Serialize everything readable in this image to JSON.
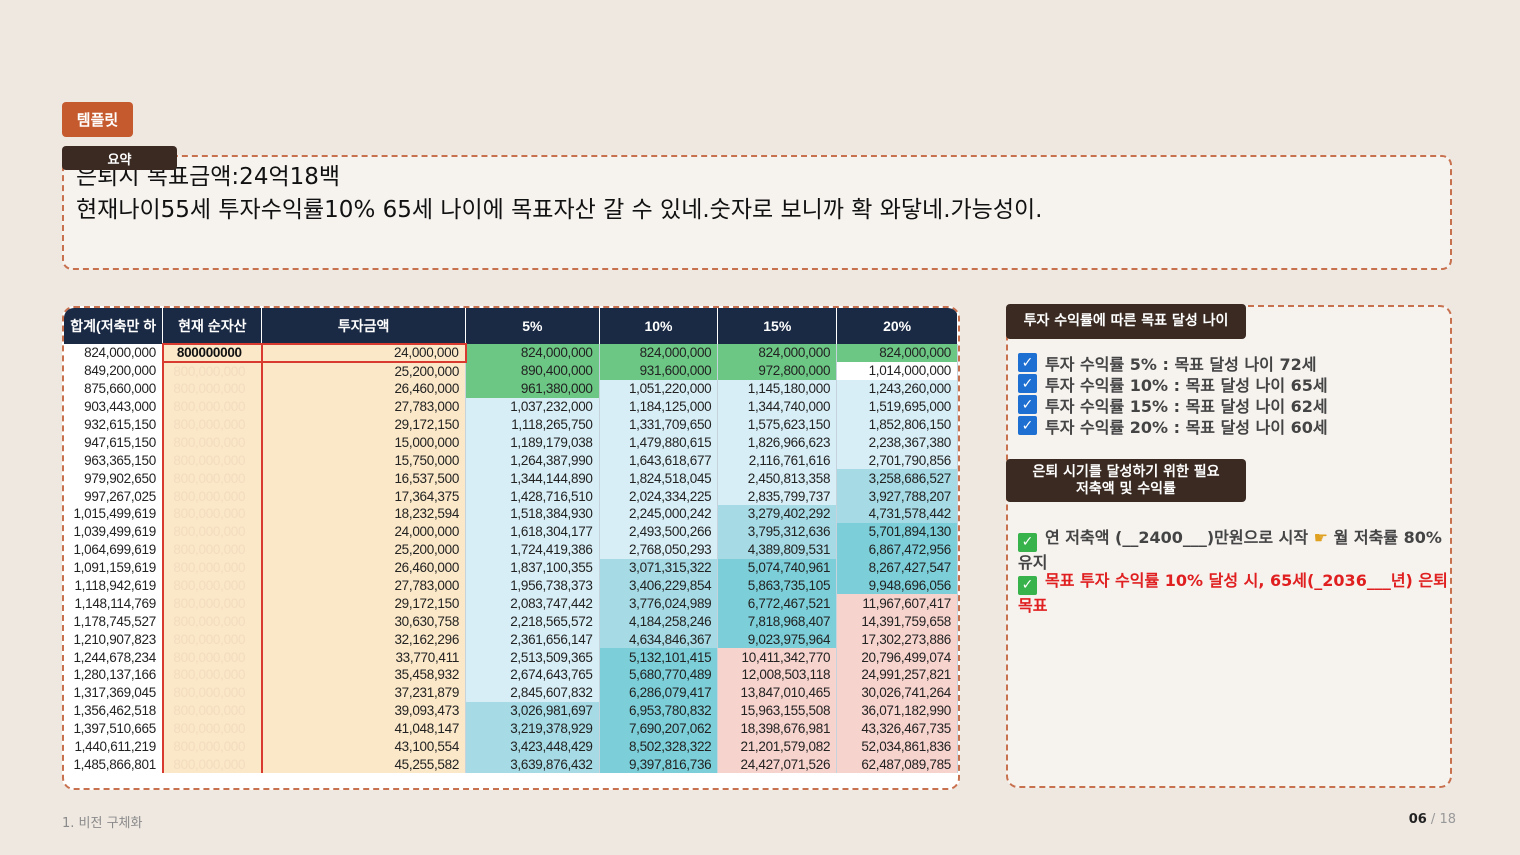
{
  "tag": "템플릿",
  "summary": {
    "label": "요약",
    "line1": "은퇴시 목표금액:24억18백",
    "line2": "현재나이55세 투자수익률10% 65세 나이에 목표자산 갈 수 있네.숫자로 보니까 확 와닿네.가능성이."
  },
  "table": {
    "headers": [
      "합계(저축만 하",
      "현재 순자산",
      "투자금액",
      "5%",
      "10%",
      "15%",
      "20%"
    ],
    "net_first": "800000000",
    "net_rest": "800,000,000",
    "rows": [
      [
        "824,000,000",
        "24,000,000",
        "824,000,000",
        "824,000,000",
        "824,000,000",
        "824,000,000"
      ],
      [
        "849,200,000",
        "25,200,000",
        "890,400,000",
        "931,600,000",
        "972,800,000",
        "1,014,000,000"
      ],
      [
        "875,660,000",
        "26,460,000",
        "961,380,000",
        "1,051,220,000",
        "1,145,180,000",
        "1,243,260,000"
      ],
      [
        "903,443,000",
        "27,783,000",
        "1,037,232,000",
        "1,184,125,000",
        "1,344,740,000",
        "1,519,695,000"
      ],
      [
        "932,615,150",
        "29,172,150",
        "1,118,265,750",
        "1,331,709,650",
        "1,575,623,150",
        "1,852,806,150"
      ],
      [
        "947,615,150",
        "15,000,000",
        "1,189,179,038",
        "1,479,880,615",
        "1,826,966,623",
        "2,238,367,380"
      ],
      [
        "963,365,150",
        "15,750,000",
        "1,264,387,990",
        "1,643,618,677",
        "2,116,761,616",
        "2,701,790,856"
      ],
      [
        "979,902,650",
        "16,537,500",
        "1,344,144,890",
        "1,824,518,045",
        "2,450,813,358",
        "3,258,686,527"
      ],
      [
        "997,267,025",
        "17,364,375",
        "1,428,716,510",
        "2,024,334,225",
        "2,835,799,737",
        "3,927,788,207"
      ],
      [
        "1,015,499,619",
        "18,232,594",
        "1,518,384,930",
        "2,245,000,242",
        "3,279,402,292",
        "4,731,578,442"
      ],
      [
        "1,039,499,619",
        "24,000,000",
        "1,618,304,177",
        "2,493,500,266",
        "3,795,312,636",
        "5,701,894,130"
      ],
      [
        "1,064,699,619",
        "25,200,000",
        "1,724,419,386",
        "2,768,050,293",
        "4,389,809,531",
        "6,867,472,956"
      ],
      [
        "1,091,159,619",
        "26,460,000",
        "1,837,100,355",
        "3,071,315,322",
        "5,074,740,961",
        "8,267,427,547"
      ],
      [
        "1,118,942,619",
        "27,783,000",
        "1,956,738,373",
        "3,406,229,854",
        "5,863,735,105",
        "9,948,696,056"
      ],
      [
        "1,148,114,769",
        "29,172,150",
        "2,083,747,442",
        "3,776,024,989",
        "6,772,467,521",
        "11,967,607,417"
      ],
      [
        "1,178,745,527",
        "30,630,758",
        "2,218,565,572",
        "4,184,258,246",
        "7,818,968,407",
        "14,391,759,658"
      ],
      [
        "1,210,907,823",
        "32,162,296",
        "2,361,656,147",
        "4,634,846,367",
        "9,023,975,964",
        "17,302,273,886"
      ],
      [
        "1,244,678,234",
        "33,770,411",
        "2,513,509,365",
        "5,132,101,415",
        "10,411,342,770",
        "20,796,499,074"
      ],
      [
        "1,280,137,166",
        "35,458,932",
        "2,674,643,765",
        "5,680,770,489",
        "12,008,503,118",
        "24,991,257,821"
      ],
      [
        "1,317,369,045",
        "37,231,879",
        "2,845,607,832",
        "6,286,079,417",
        "13,847,010,465",
        "30,026,741,264"
      ],
      [
        "1,356,462,518",
        "39,093,473",
        "3,026,981,697",
        "6,953,780,832",
        "15,963,155,508",
        "36,071,182,990"
      ],
      [
        "1,397,510,665",
        "41,048,147",
        "3,219,378,929",
        "7,690,207,062",
        "18,398,676,981",
        "43,326,467,735"
      ],
      [
        "1,440,611,219",
        "43,100,554",
        "3,423,448,429",
        "8,502,328,322",
        "21,201,579,082",
        "52,034,861,836"
      ],
      [
        "1,485,866,801",
        "45,255,582",
        "3,639,876,432",
        "9,397,816,736",
        "24,427,071,526",
        "62,487,089,785"
      ]
    ]
  },
  "right": {
    "badge1": "투자 수익률에 따른 목표 달성 나이",
    "checks": [
      "투자 수익률 5% : 목표 달성 나이 72세",
      "투자 수익률 10% : 목표 달성 나이 65세",
      "투자 수익률 15% : 목표 달성 나이 62세",
      "투자 수익률 20% : 목표 달성 나이 60세"
    ],
    "badge2_line1": "은퇴 시기를 달성하기 위한 필요",
    "badge2_line2": "저축액 및 수익률",
    "goal1_a": "연 저축액 (__2400___)만원으로 시작",
    "goal1_b": "월 저축률 80% 유지",
    "goal2": "목표 투자 수익률 10% 달성 시, 65세(_2036___년) 은퇴 목표"
  },
  "footer": {
    "section": "1. 비전 구체화",
    "page": "06",
    "sep": "/",
    "total": "18"
  },
  "colors": {
    "accent": "#c55a2e",
    "dark_badge": "#3a2a22",
    "header_navy": "#1b2a44",
    "green": "#6cc784",
    "light_blue": "#d7eef6",
    "mid_blue": "#a6dbe5",
    "dark_blue": "#7ccfd9",
    "pink": "#f7d3cd",
    "goal_red": "#e02020"
  }
}
